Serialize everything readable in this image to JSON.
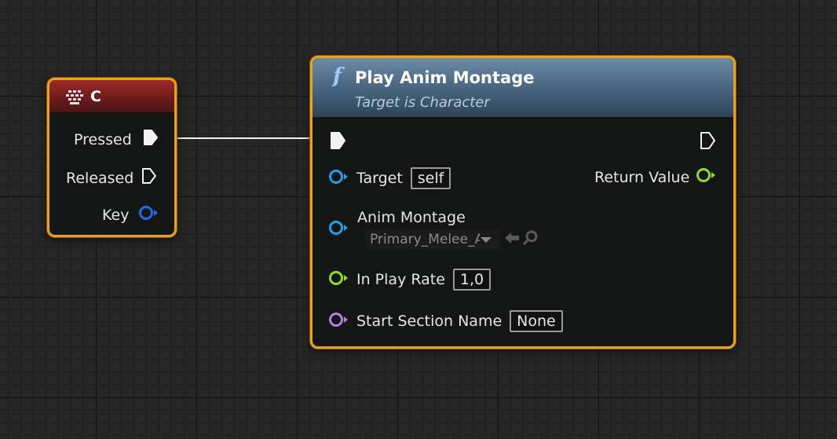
{
  "key_event_node": {
    "title": "C",
    "icon": "keyboard-icon",
    "pins": [
      {
        "label": "Pressed",
        "type": "exec"
      },
      {
        "label": "Released",
        "type": "exec"
      },
      {
        "label": "Key",
        "type": "data"
      }
    ]
  },
  "play_anim_node": {
    "icon": "function-icon",
    "icon_glyph": "f",
    "title": "Play Anim Montage",
    "subtitle": "Target is Character",
    "target": {
      "label": "Target",
      "value": "self"
    },
    "return_value": {
      "label": "Return Value"
    },
    "anim_montage": {
      "label": "Anim Montage",
      "value": "Primary_Melee_A"
    },
    "play_rate": {
      "label": "In Play Rate",
      "value": "1,0"
    },
    "start_section": {
      "label": "Start Section Name",
      "value": "None"
    }
  },
  "colors": {
    "node_border": "#e8a21b",
    "event_header": "#9c2a2a",
    "function_header": "#4c6a84",
    "object_pin": "#1ea0e8",
    "struct_pin": "#1e6ee8",
    "float_pin": "#8be01e",
    "name_pin": "#c07ae8"
  }
}
